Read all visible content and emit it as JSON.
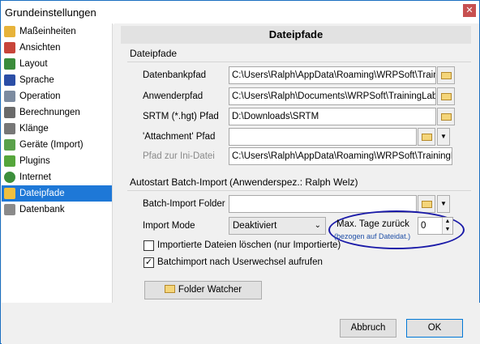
{
  "window": {
    "title": "Grundeinstellungen",
    "close_glyph": "✕"
  },
  "sidebar": {
    "items": [
      {
        "label": "Maßeinheiten",
        "icon": "ruler-icon",
        "color": "#e7b33a"
      },
      {
        "label": "Ansichten",
        "icon": "calendar-icon",
        "color": "#c8453a"
      },
      {
        "label": "Layout",
        "icon": "layout-icon",
        "color": "#3b8c3b"
      },
      {
        "label": "Sprache",
        "icon": "flag-icon",
        "color": "#2b4ea6"
      },
      {
        "label": "Operation",
        "icon": "wrench-icon",
        "color": "#7c8ba0"
      },
      {
        "label": "Berechnungen",
        "icon": "calculator-icon",
        "color": "#6a6a6a"
      },
      {
        "label": "Klänge",
        "icon": "speaker-icon",
        "color": "#777777"
      },
      {
        "label": "Geräte (Import)",
        "icon": "device-icon",
        "color": "#5aa14a"
      },
      {
        "label": "Plugins",
        "icon": "puzzle-icon",
        "color": "#55a63b"
      },
      {
        "label": "Internet",
        "icon": "globe-icon",
        "color": "#3c8f3c"
      },
      {
        "label": "Dateipfade",
        "icon": "folder-icon",
        "color": "#f0c040"
      },
      {
        "label": "Datenbank",
        "icon": "database-icon",
        "color": "#8a8a8a"
      }
    ],
    "selected_index": 10,
    "selected_color": "#1e78d7"
  },
  "main": {
    "header": "Dateipfade",
    "section1": "Dateipfade",
    "fields": [
      {
        "label": "Datenbankpfad",
        "value": "C:\\Users\\Ralph\\AppData\\Roaming\\WRPSoft\\Training"
      },
      {
        "label": "Anwenderpfad",
        "value": "C:\\Users\\Ralph\\Documents\\WRPSoft\\TrainingLab"
      },
      {
        "label": "SRTM (*.hgt) Pfad",
        "value": "D:\\Downloads\\SRTM"
      },
      {
        "label": "'Attachment' Pfad",
        "value": ""
      },
      {
        "label": "Pfad zur Ini-Datei",
        "value": "C:\\Users\\Ralph\\AppData\\Roaming\\WRPSoft\\TrainingLab\\"
      }
    ],
    "section2": "Autostart Batch-Import",
    "section2_note": "(Anwenderspez.: Ralph Welz)",
    "batch_folder_label": "Batch-Import Folder",
    "batch_folder_value": "",
    "import_mode_label": "Import Mode",
    "import_mode_value": "Deaktiviert",
    "max_days_label": "Max. Tage zurück",
    "max_days_hint": "(bezogen auf Dateidat.)",
    "max_days_value": "0",
    "checkbox1": {
      "label": "Importierte Dateien löschen (nur Importierte)",
      "checked": false,
      "mark": ""
    },
    "checkbox2": {
      "label": "Batchimport nach Userwechsel aufrufen",
      "checked": true,
      "mark": "✓"
    },
    "folder_watcher": "Folder Watcher"
  },
  "footer": {
    "cancel": "Abbruch",
    "ok": "OK"
  },
  "colors": {
    "highlight_ellipse": "#1a1aa8",
    "hint_text": "#1f4fa6"
  }
}
